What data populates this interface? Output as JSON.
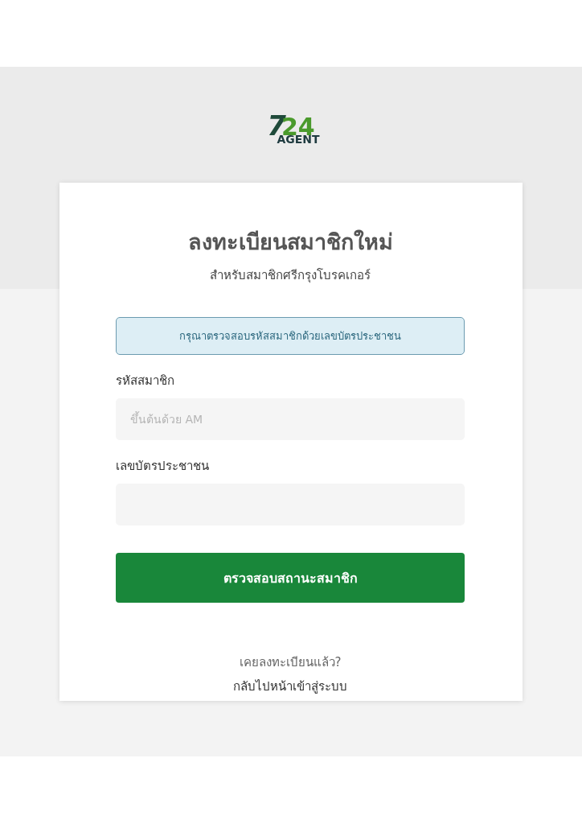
{
  "logo": {
    "lead": "7",
    "accent": "24",
    "word": "AGENT"
  },
  "title": "ลงทะเบียนสมาชิกใหม่",
  "subtitle": "สำหรับสมาชิกศรีกรุงโบรคเกอร์",
  "notice": "กรุณาตรวจสอบรหัสสมาชิกด้วยเลขบัตรประชาชน",
  "fields": [
    {
      "label": "รหัสสมาชิก",
      "placeholder": "ขึ้นต้นด้วย AM"
    },
    {
      "label": "เลขบัตรประชาชน"
    }
  ],
  "submit": "ตรวจสอบสถานะสมาชิก",
  "footer": {
    "question": "เคยลงทะเบียนแล้ว?",
    "link": "กลับไปหน้าเข้าสู่ระบบ"
  }
}
